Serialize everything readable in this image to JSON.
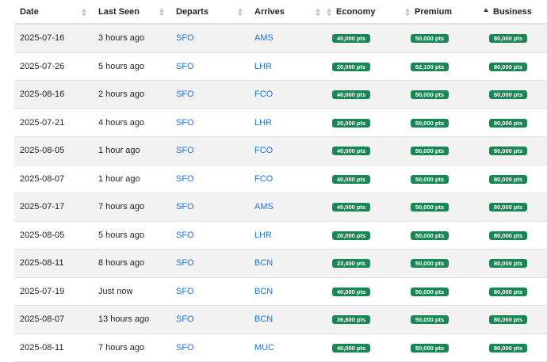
{
  "columns": [
    {
      "label": "Date",
      "sort": "none"
    },
    {
      "label": "Last Seen",
      "sort": "none"
    },
    {
      "label": "Departs",
      "sort": "none"
    },
    {
      "label": "Arrives",
      "sort": "none"
    },
    {
      "label": "Economy",
      "sort": "none"
    },
    {
      "label": "Premium",
      "sort": "none"
    },
    {
      "label": "Business",
      "sort": "asc"
    }
  ],
  "rows": [
    {
      "date": "2025-07-16",
      "seen": "3 hours ago",
      "departs": "SFO",
      "arrives": "AMS",
      "economy": "40,000 pts",
      "premium": "50,000 pts",
      "business": "80,000 pts"
    },
    {
      "date": "2025-07-26",
      "seen": "5 hours ago",
      "departs": "SFO",
      "arrives": "LHR",
      "economy": "20,000 pts",
      "premium": "62,100 pts",
      "business": "80,000 pts"
    },
    {
      "date": "2025-08-16",
      "seen": "2 hours ago",
      "departs": "SFO",
      "arrives": "FCO",
      "economy": "40,000 pts",
      "premium": "50,000 pts",
      "business": "80,000 pts"
    },
    {
      "date": "2025-07-21",
      "seen": "4 hours ago",
      "departs": "SFO",
      "arrives": "LHR",
      "economy": "20,000 pts",
      "premium": "50,000 pts",
      "business": "80,000 pts"
    },
    {
      "date": "2025-08-05",
      "seen": "1 hour ago",
      "departs": "SFO",
      "arrives": "FCO",
      "economy": "40,000 pts",
      "premium": "50,000 pts",
      "business": "80,000 pts"
    },
    {
      "date": "2025-08-07",
      "seen": "1 hour ago",
      "departs": "SFO",
      "arrives": "FCO",
      "economy": "40,000 pts",
      "premium": "50,000 pts",
      "business": "80,000 pts"
    },
    {
      "date": "2025-07-17",
      "seen": "7 hours ago",
      "departs": "SFO",
      "arrives": "AMS",
      "economy": "40,000 pts",
      "premium": "50,000 pts",
      "business": "80,000 pts"
    },
    {
      "date": "2025-08-05",
      "seen": "5 hours ago",
      "departs": "SFO",
      "arrives": "LHR",
      "economy": "20,000 pts",
      "premium": "50,000 pts",
      "business": "80,000 pts"
    },
    {
      "date": "2025-08-11",
      "seen": "8 hours ago",
      "departs": "SFO",
      "arrives": "BCN",
      "economy": "23,400 pts",
      "premium": "50,000 pts",
      "business": "80,000 pts"
    },
    {
      "date": "2025-07-19",
      "seen": "Just now",
      "departs": "SFO",
      "arrives": "BCN",
      "economy": "40,000 pts",
      "premium": "50,000 pts",
      "business": "80,000 pts"
    },
    {
      "date": "2025-08-07",
      "seen": "13 hours ago",
      "departs": "SFO",
      "arrives": "BCN",
      "economy": "36,800 pts",
      "premium": "50,000 pts",
      "business": "80,000 pts"
    },
    {
      "date": "2025-08-11",
      "seen": "7 hours ago",
      "departs": "SFO",
      "arrives": "MUC",
      "economy": "40,000 pts",
      "premium": "50,000 pts",
      "business": "80,000 pts"
    }
  ],
  "colors": {
    "link": "#1a73e8",
    "badge": "#198754",
    "stripe": "#f2f2f2"
  },
  "icons": {
    "sort": "sort-icon",
    "sort_asc": "sort-asc-icon"
  }
}
